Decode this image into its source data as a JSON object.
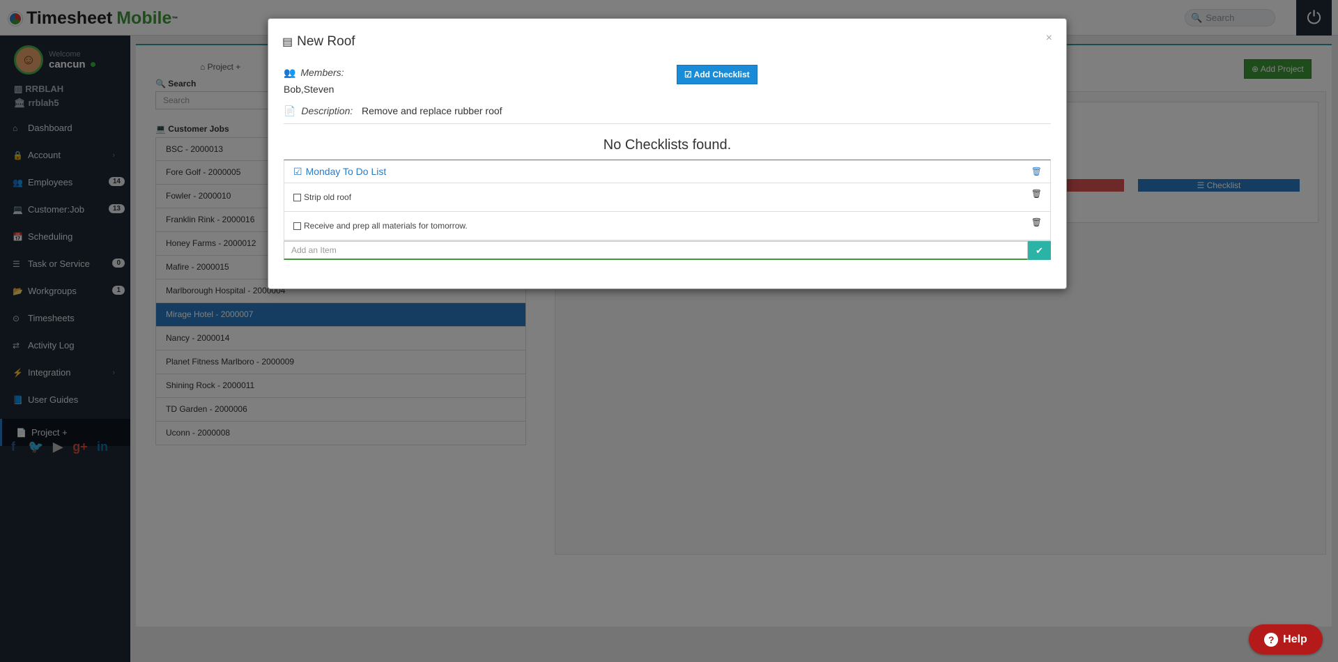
{
  "app": {
    "brand_part1": "Timesheet",
    "brand_part2": "Mobile",
    "trademark": "™"
  },
  "topbar": {
    "search_placeholder": "Search"
  },
  "profile": {
    "welcome": "Welcome",
    "username": "cancun",
    "org1": "RRBLAH",
    "org2": "rrblah5"
  },
  "nav": [
    {
      "label": "Dashboard",
      "icon": "home-icon",
      "glyph": "⌂",
      "badge": ""
    },
    {
      "label": "Account",
      "icon": "lock-icon",
      "glyph": "🔒",
      "badge": "",
      "caret": "›"
    },
    {
      "label": "Employees",
      "icon": "users-icon",
      "glyph": "👥",
      "badge": "14"
    },
    {
      "label": "Customer:Job",
      "icon": "laptop-icon",
      "glyph": "💻",
      "badge": "13"
    },
    {
      "label": "Scheduling",
      "icon": "calendar-icon",
      "glyph": "📅",
      "badge": ""
    },
    {
      "label": "Task or Service",
      "icon": "list-icon",
      "glyph": "☰",
      "badge": "0"
    },
    {
      "label": "Workgroups",
      "icon": "folder-icon",
      "glyph": "📂",
      "badge": "1"
    },
    {
      "label": "Timesheets",
      "icon": "clock-icon",
      "glyph": "⊙",
      "badge": ""
    },
    {
      "label": "Activity Log",
      "icon": "exchange-icon",
      "glyph": "⇄",
      "badge": ""
    },
    {
      "label": "Integration",
      "icon": "plug-icon",
      "glyph": "⚡",
      "badge": "",
      "caret": "›"
    },
    {
      "label": "User Guides",
      "icon": "book-icon",
      "glyph": "📘",
      "badge": ""
    }
  ],
  "nav_active": {
    "label": "Project +",
    "icon": "file-icon",
    "glyph": "📄"
  },
  "main": {
    "project_tab": "Project +",
    "search_label": "Search",
    "search_placeholder": "Search",
    "customer_jobs_label": "Customer Jobs",
    "add_project": "Add Project",
    "checklist_btn": "Checklist",
    "jobs": [
      "BSC - 2000013",
      "Fore Golf - 2000005",
      "Fowler - 2000010",
      "Franklin Rink - 2000016",
      "Honey Farms - 2000012",
      "Mafire - 2000015",
      "Marlborough Hospital - 2000004",
      "Mirage Hotel - 2000007",
      "Nancy - 2000014",
      "Planet Fitness Marlboro - 2000009",
      "Shining Rock - 2000011",
      "TD Garden - 2000006",
      "Uconn - 2000008"
    ],
    "selected_job": 7
  },
  "modal": {
    "title": "New Roof",
    "close": "×",
    "members_label": "Members:",
    "members_value": "Bob,Steven",
    "add_checklist": "Add Checklist",
    "description_label": "Description:",
    "description_value": "Remove and replace rubber roof",
    "no_checklists": "No Checklists found.",
    "checklist": {
      "title": "Monday To Do List",
      "items": [
        "Strip old roof",
        "Receive and prep all materials for tomorrow."
      ]
    },
    "add_item_placeholder": "Add an Item"
  },
  "help": {
    "label": "Help"
  },
  "colors": {
    "sidebar": "#1d2833",
    "accent_blue": "#2b7bc4",
    "brand_green": "#3c9a37",
    "help_red": "#b51a1a",
    "teal": "#2bb3a6"
  }
}
